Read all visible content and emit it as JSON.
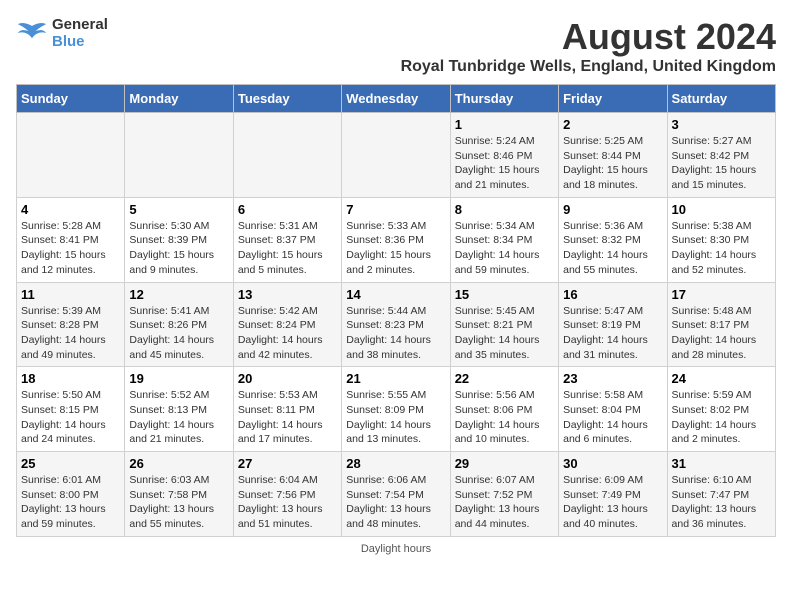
{
  "logo": {
    "line1": "General",
    "line2": "Blue"
  },
  "title": "August 2024",
  "subtitle": "Royal Tunbridge Wells, England, United Kingdom",
  "weekdays": [
    "Sunday",
    "Monday",
    "Tuesday",
    "Wednesday",
    "Thursday",
    "Friday",
    "Saturday"
  ],
  "footer": "Daylight hours",
  "weeks": [
    [
      {
        "day": "",
        "info": ""
      },
      {
        "day": "",
        "info": ""
      },
      {
        "day": "",
        "info": ""
      },
      {
        "day": "",
        "info": ""
      },
      {
        "day": "1",
        "info": "Sunrise: 5:24 AM\nSunset: 8:46 PM\nDaylight: 15 hours\nand 21 minutes."
      },
      {
        "day": "2",
        "info": "Sunrise: 5:25 AM\nSunset: 8:44 PM\nDaylight: 15 hours\nand 18 minutes."
      },
      {
        "day": "3",
        "info": "Sunrise: 5:27 AM\nSunset: 8:42 PM\nDaylight: 15 hours\nand 15 minutes."
      }
    ],
    [
      {
        "day": "4",
        "info": "Sunrise: 5:28 AM\nSunset: 8:41 PM\nDaylight: 15 hours\nand 12 minutes."
      },
      {
        "day": "5",
        "info": "Sunrise: 5:30 AM\nSunset: 8:39 PM\nDaylight: 15 hours\nand 9 minutes."
      },
      {
        "day": "6",
        "info": "Sunrise: 5:31 AM\nSunset: 8:37 PM\nDaylight: 15 hours\nand 5 minutes."
      },
      {
        "day": "7",
        "info": "Sunrise: 5:33 AM\nSunset: 8:36 PM\nDaylight: 15 hours\nand 2 minutes."
      },
      {
        "day": "8",
        "info": "Sunrise: 5:34 AM\nSunset: 8:34 PM\nDaylight: 14 hours\nand 59 minutes."
      },
      {
        "day": "9",
        "info": "Sunrise: 5:36 AM\nSunset: 8:32 PM\nDaylight: 14 hours\nand 55 minutes."
      },
      {
        "day": "10",
        "info": "Sunrise: 5:38 AM\nSunset: 8:30 PM\nDaylight: 14 hours\nand 52 minutes."
      }
    ],
    [
      {
        "day": "11",
        "info": "Sunrise: 5:39 AM\nSunset: 8:28 PM\nDaylight: 14 hours\nand 49 minutes."
      },
      {
        "day": "12",
        "info": "Sunrise: 5:41 AM\nSunset: 8:26 PM\nDaylight: 14 hours\nand 45 minutes."
      },
      {
        "day": "13",
        "info": "Sunrise: 5:42 AM\nSunset: 8:24 PM\nDaylight: 14 hours\nand 42 minutes."
      },
      {
        "day": "14",
        "info": "Sunrise: 5:44 AM\nSunset: 8:23 PM\nDaylight: 14 hours\nand 38 minutes."
      },
      {
        "day": "15",
        "info": "Sunrise: 5:45 AM\nSunset: 8:21 PM\nDaylight: 14 hours\nand 35 minutes."
      },
      {
        "day": "16",
        "info": "Sunrise: 5:47 AM\nSunset: 8:19 PM\nDaylight: 14 hours\nand 31 minutes."
      },
      {
        "day": "17",
        "info": "Sunrise: 5:48 AM\nSunset: 8:17 PM\nDaylight: 14 hours\nand 28 minutes."
      }
    ],
    [
      {
        "day": "18",
        "info": "Sunrise: 5:50 AM\nSunset: 8:15 PM\nDaylight: 14 hours\nand 24 minutes."
      },
      {
        "day": "19",
        "info": "Sunrise: 5:52 AM\nSunset: 8:13 PM\nDaylight: 14 hours\nand 21 minutes."
      },
      {
        "day": "20",
        "info": "Sunrise: 5:53 AM\nSunset: 8:11 PM\nDaylight: 14 hours\nand 17 minutes."
      },
      {
        "day": "21",
        "info": "Sunrise: 5:55 AM\nSunset: 8:09 PM\nDaylight: 14 hours\nand 13 minutes."
      },
      {
        "day": "22",
        "info": "Sunrise: 5:56 AM\nSunset: 8:06 PM\nDaylight: 14 hours\nand 10 minutes."
      },
      {
        "day": "23",
        "info": "Sunrise: 5:58 AM\nSunset: 8:04 PM\nDaylight: 14 hours\nand 6 minutes."
      },
      {
        "day": "24",
        "info": "Sunrise: 5:59 AM\nSunset: 8:02 PM\nDaylight: 14 hours\nand 2 minutes."
      }
    ],
    [
      {
        "day": "25",
        "info": "Sunrise: 6:01 AM\nSunset: 8:00 PM\nDaylight: 13 hours\nand 59 minutes."
      },
      {
        "day": "26",
        "info": "Sunrise: 6:03 AM\nSunset: 7:58 PM\nDaylight: 13 hours\nand 55 minutes."
      },
      {
        "day": "27",
        "info": "Sunrise: 6:04 AM\nSunset: 7:56 PM\nDaylight: 13 hours\nand 51 minutes."
      },
      {
        "day": "28",
        "info": "Sunrise: 6:06 AM\nSunset: 7:54 PM\nDaylight: 13 hours\nand 48 minutes."
      },
      {
        "day": "29",
        "info": "Sunrise: 6:07 AM\nSunset: 7:52 PM\nDaylight: 13 hours\nand 44 minutes."
      },
      {
        "day": "30",
        "info": "Sunrise: 6:09 AM\nSunset: 7:49 PM\nDaylight: 13 hours\nand 40 minutes."
      },
      {
        "day": "31",
        "info": "Sunrise: 6:10 AM\nSunset: 7:47 PM\nDaylight: 13 hours\nand 36 minutes."
      }
    ]
  ]
}
